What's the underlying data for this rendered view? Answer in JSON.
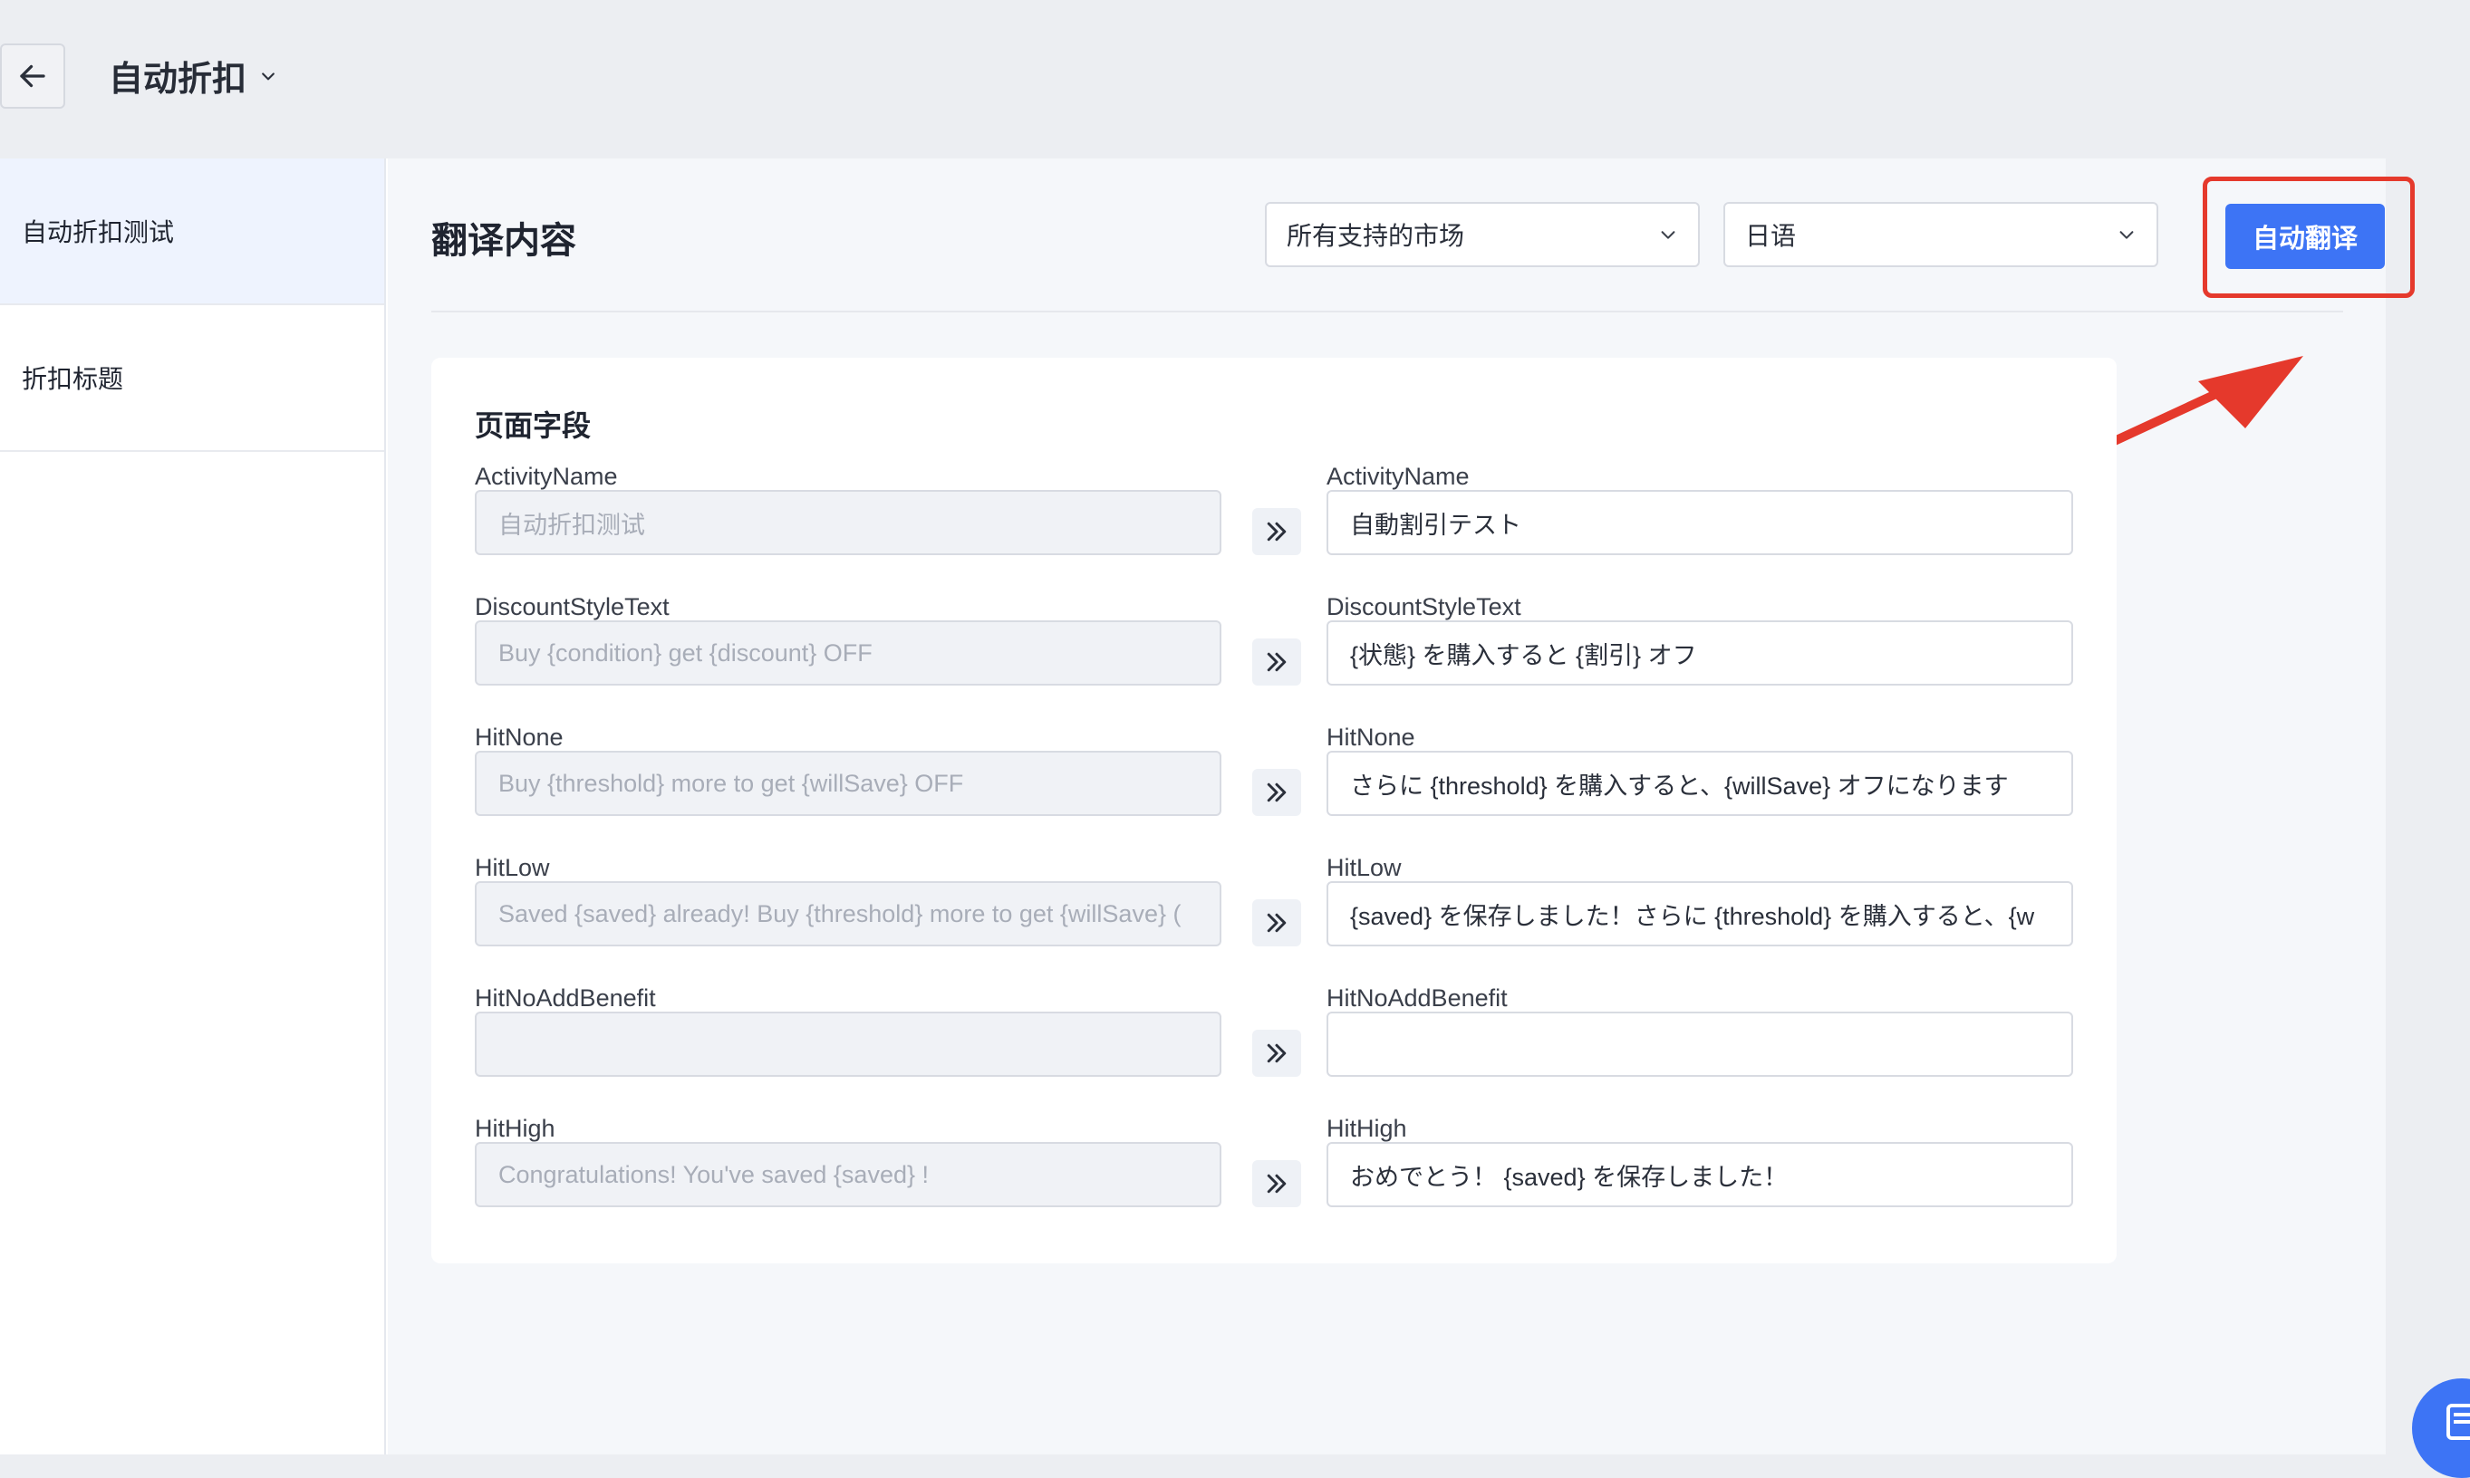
{
  "header": {
    "title": "自动折扣"
  },
  "sidebar": {
    "items": [
      {
        "label": "自动折扣测试"
      },
      {
        "label": "折扣标题"
      }
    ]
  },
  "content": {
    "title": "翻译内容",
    "market_select": "所有支持的市场",
    "language_select": "日语",
    "auto_translate_label": "自动翻译"
  },
  "card": {
    "title": "页面字段",
    "fields": [
      {
        "label": "ActivityName",
        "source": "自动折扣测试",
        "target": "自動割引テスト"
      },
      {
        "label": "DiscountStyleText",
        "source": "Buy {condition} get {discount} OFF",
        "target": "{状態} を購入すると {割引} オフ"
      },
      {
        "label": "HitNone",
        "source": "Buy {threshold} more to get {willSave} OFF",
        "target": "さらに {threshold} を購入すると、{willSave} オフになります"
      },
      {
        "label": "HitLow",
        "source": "Saved {saved} already! Buy {threshold} more to get {willSave} (",
        "target": "{saved} を保存しました！さらに {threshold} を購入すると、{w"
      },
      {
        "label": "HitNoAddBenefit",
        "source": "",
        "target": ""
      },
      {
        "label": "HitHigh",
        "source": "Congratulations! You've saved {saved} !",
        "target": "おめでとう！ {saved} を保存しました！"
      }
    ]
  },
  "colors": {
    "accent": "#3d74f5",
    "highlight": "#e5392c",
    "sidebar_active": "#eef3fe"
  },
  "icons": {
    "back": "arrow-left-icon",
    "dropdown": "chevron-down-icon",
    "copy": "double-chevron-right-icon"
  }
}
